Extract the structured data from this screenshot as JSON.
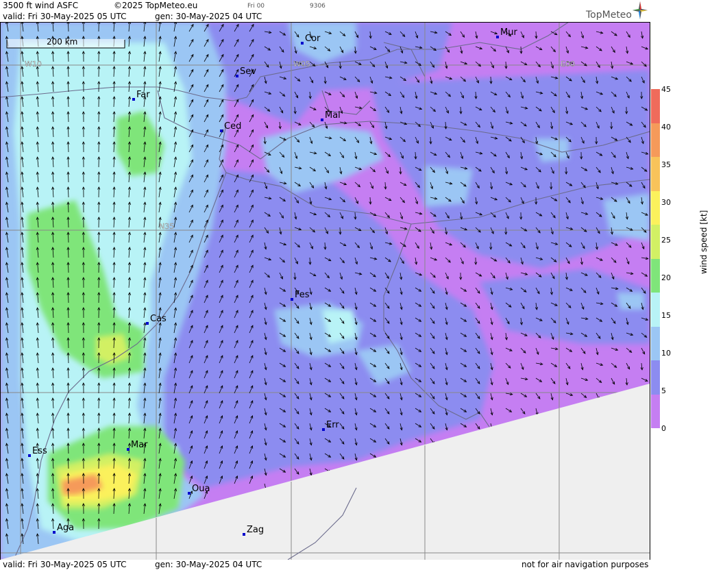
{
  "header": {
    "title": "3500 ft wind ASFC",
    "copyright": "©2025 TopMeteo.eu",
    "day_code": "Fri 00",
    "code": "9306",
    "valid": "valid:  Fri  30-May-2025  05 UTC",
    "gen": "gen: 30-May-2025 04 UTC",
    "logo": "TopMeteo"
  },
  "map": {
    "scale_label": "200 km",
    "grid_labels": [
      "W10",
      "W05",
      "E00",
      "N35"
    ],
    "cities": [
      {
        "name": "Cor"
      },
      {
        "name": "Mur"
      },
      {
        "name": "Sev"
      },
      {
        "name": "Far"
      },
      {
        "name": "Ced"
      },
      {
        "name": "Mal"
      },
      {
        "name": "Fes"
      },
      {
        "name": "Cas"
      },
      {
        "name": "Err"
      },
      {
        "name": "Ess"
      },
      {
        "name": "Mar"
      },
      {
        "name": "Oua"
      },
      {
        "name": "Aga"
      },
      {
        "name": "Zag"
      }
    ],
    "no_data_color": "#efefef"
  },
  "colorbar": {
    "title": "wind speed [kt]",
    "ticks": [
      "45",
      "40",
      "35",
      "30",
      "25",
      "20",
      "15",
      "10",
      "5",
      "0"
    ],
    "colors": [
      "#ef6b5b",
      "#f59a5a",
      "#f8c35a",
      "#fbf15c",
      "#d2f064",
      "#7fe57a",
      "#b8f3f6",
      "#9bc6f4",
      "#8c8cf0",
      "#c57ef2"
    ]
  },
  "footer": {
    "valid": "valid:  Fri  30-May-2025  05 UTC",
    "gen": "gen: 30-May-2025 04 UTC",
    "disclaimer": "not for air navigation purposes"
  }
}
